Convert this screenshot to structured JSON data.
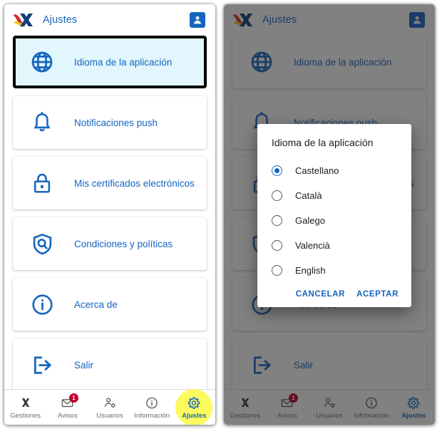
{
  "header": {
    "logo_icon": "agencia-tributaria-logo",
    "title": "Ajustes",
    "avatar_icon": "user-avatar-icon"
  },
  "settings": {
    "items": [
      {
        "icon": "globe-icon",
        "label": "Idioma de la aplicación"
      },
      {
        "icon": "bell-icon",
        "label": "Notificaciones push"
      },
      {
        "icon": "lock-icon",
        "label": "Mis certificados electrónicos"
      },
      {
        "icon": "shield-search-icon",
        "label": "Condiciones y políticas"
      },
      {
        "icon": "info-icon",
        "label": "Acerca de"
      },
      {
        "icon": "logout-icon",
        "label": "Salir"
      }
    ]
  },
  "bottom_nav": {
    "items": [
      {
        "icon": "agencia-x-icon",
        "label": "Gestiones",
        "badge": ""
      },
      {
        "icon": "envelope-icon",
        "label": "Avisos",
        "badge": "1"
      },
      {
        "icon": "users-gear-icon",
        "label": "Usuarios",
        "badge": ""
      },
      {
        "icon": "info-circle-icon",
        "label": "Información",
        "badge": ""
      },
      {
        "icon": "gear-icon",
        "label": "Ajustes",
        "badge": ""
      }
    ],
    "active_index": 4
  },
  "dialog": {
    "title": "Idioma de la aplicación",
    "options": [
      {
        "label": "Castellano",
        "selected": true
      },
      {
        "label": "Català",
        "selected": false
      },
      {
        "label": "Galego",
        "selected": false
      },
      {
        "label": "Valencià",
        "selected": false
      },
      {
        "label": "English",
        "selected": false
      }
    ],
    "cancel_label": "CANCELAR",
    "accept_label": "ACEPTAR"
  },
  "colors": {
    "brand_blue": "#1565c0",
    "focus_outline": "#000000",
    "focus_fill": "#e1f6fd",
    "highlight_yellow": "#fcfa5e",
    "badge_red": "#c2002f",
    "scrim": "rgba(30,30,30,.56)"
  }
}
